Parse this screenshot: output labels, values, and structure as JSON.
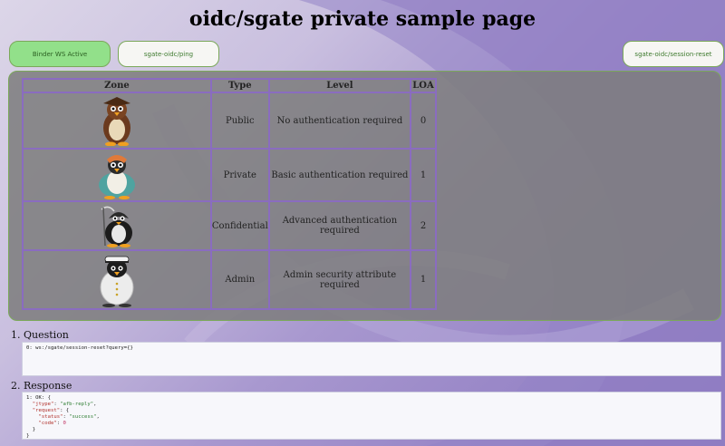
{
  "page": {
    "title": "oidc/sgate private sample page"
  },
  "toolbar": {
    "binder_label": "Binder WS Active",
    "ping_label": "sgate-oidc/ping",
    "reset_label": "sgate-oidc/session-reset"
  },
  "table": {
    "headers": {
      "zone": "Zone",
      "type": "Type",
      "level": "Level",
      "loa": "LOA"
    },
    "rows": [
      {
        "icon": "tux-public-icon",
        "type": "Public",
        "level": "No authentication required",
        "loa": "0"
      },
      {
        "icon": "tux-private-icon",
        "type": "Private",
        "level": "Basic authentication required",
        "loa": "1"
      },
      {
        "icon": "tux-confidential-icon",
        "type": "Confidential",
        "level": "Advanced authentication required",
        "loa": "2"
      },
      {
        "icon": "tux-admin-icon",
        "type": "Admin",
        "level": "Admin security attribute required",
        "loa": "1"
      }
    ]
  },
  "question": {
    "label": "1. Question",
    "line": "0: ws:/sgate/session-reset?query={}"
  },
  "response": {
    "label": "2. Response",
    "header": "1: OK: {",
    "jtype_key": "\"jtype\"",
    "jtype_val": "\"afb-reply\"",
    "request_key": "\"request\"",
    "status_key": "\"status\"",
    "status_val": "\"success\"",
    "code_key": "\"code\"",
    "code_val": "0"
  },
  "colors": {
    "accent": "#7ba85a",
    "active_button": "#92e08a",
    "table_border": "#8a6cc0"
  }
}
